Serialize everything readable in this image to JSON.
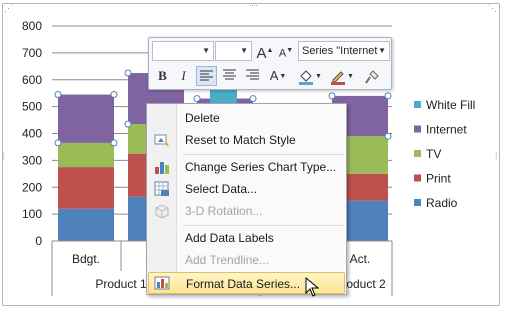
{
  "chart_data": {
    "type": "bar",
    "stacked": true,
    "ylim": [
      0,
      800
    ],
    "yticks": [
      "0",
      "100",
      "200",
      "300",
      "400",
      "500",
      "600",
      "700",
      "800"
    ],
    "categories": [
      "Bdgt.",
      "Act.",
      "Bdgt.",
      "Act."
    ],
    "groups": [
      "Product 1",
      "Product 2"
    ],
    "series": [
      {
        "name": "Radio",
        "color": "#4f81bd",
        "values": [
          120,
          165,
          115,
          150
        ]
      },
      {
        "name": "Print",
        "color": "#c0504d",
        "values": [
          155,
          160,
          155,
          100
        ]
      },
      {
        "name": "TV",
        "color": "#9bbb59",
        "values": [
          90,
          110,
          85,
          140
        ]
      },
      {
        "name": "Internet",
        "color": "#8064a2",
        "values": [
          180,
          190,
          175,
          150
        ]
      },
      {
        "name": "White Fill",
        "color": "#4bacc6",
        "values": [
          0,
          0,
          0,
          0
        ]
      }
    ],
    "legend": [
      "White Fill",
      "Internet",
      "TV",
      "Print",
      "Radio"
    ],
    "legend_position": "right",
    "grid": true
  },
  "toolbar": {
    "font_name": "",
    "font_size": "",
    "grow_font": "A",
    "shrink_font": "A",
    "element_selector": "Series \"Internet",
    "bold": "B",
    "italic": "I",
    "font_color": "A"
  },
  "menu": {
    "items": [
      {
        "label": "Delete",
        "icon": "none",
        "disabled": false
      },
      {
        "label": "Reset to Match Style",
        "icon": "reset-style-icon",
        "disabled": false
      },
      {
        "label": "Change Series Chart Type...",
        "icon": "chart-type-icon",
        "disabled": false
      },
      {
        "label": "Select Data...",
        "icon": "select-data-icon",
        "disabled": false
      },
      {
        "label": "3-D Rotation...",
        "icon": "rotation-3d-icon",
        "disabled": true
      },
      {
        "label": "Add Data Labels",
        "icon": "none",
        "disabled": false
      },
      {
        "label": "Add Trendline...",
        "icon": "none",
        "disabled": true
      },
      {
        "label": "Format Data Series...",
        "icon": "format-series-icon",
        "disabled": false,
        "highlighted": true
      }
    ]
  }
}
